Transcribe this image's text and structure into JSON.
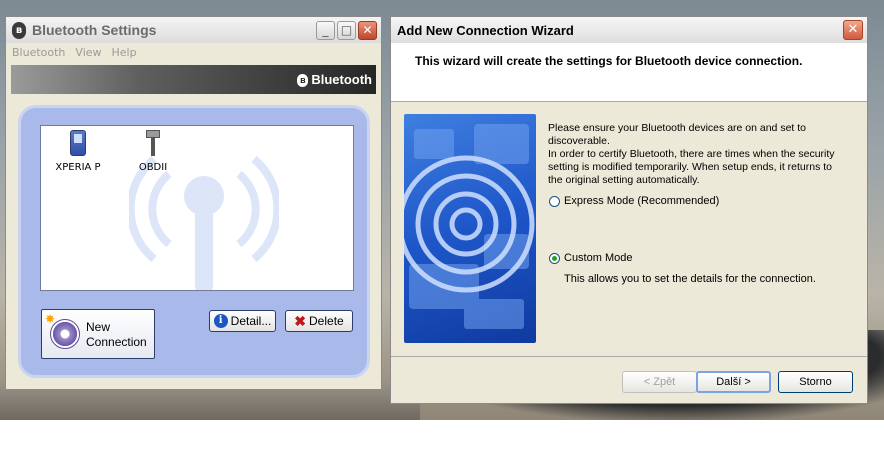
{
  "bt_window": {
    "title": "Bluetooth Settings",
    "menu": [
      "Bluetooth",
      "View",
      "Help"
    ],
    "banner_label": "Bluetooth",
    "devices": [
      {
        "name": "XPERIA P",
        "icon": "phone-icon"
      },
      {
        "name": "OBDII",
        "icon": "obd-plug-icon"
      }
    ],
    "buttons": {
      "new_connection_line1": "New",
      "new_connection_line2": "Connection",
      "detail": "Detail...",
      "delete": "Delete"
    }
  },
  "wizard": {
    "title": "Add New Connection Wizard",
    "header": "This wizard will create the settings for Bluetooth device connection.",
    "description": "Please ensure your Bluetooth devices are on and set to discoverable.\nIn order to certify Bluetooth, there are times when the security setting is modified temporarily. When setup ends, it returns to the original setting automatically.",
    "options": [
      {
        "label": "Express Mode (Recommended)",
        "selected": false
      },
      {
        "label": "Custom Mode",
        "selected": true
      }
    ],
    "custom_desc": "This allows you to set the details for the connection.",
    "buttons": {
      "back": "< Zpět",
      "next": "Další >",
      "cancel": "Storno"
    }
  },
  "colors": {
    "panel_blue": "#a8b9ea",
    "wizard_image_blue": "#1e56c8",
    "radio_selected": "#21a121"
  }
}
